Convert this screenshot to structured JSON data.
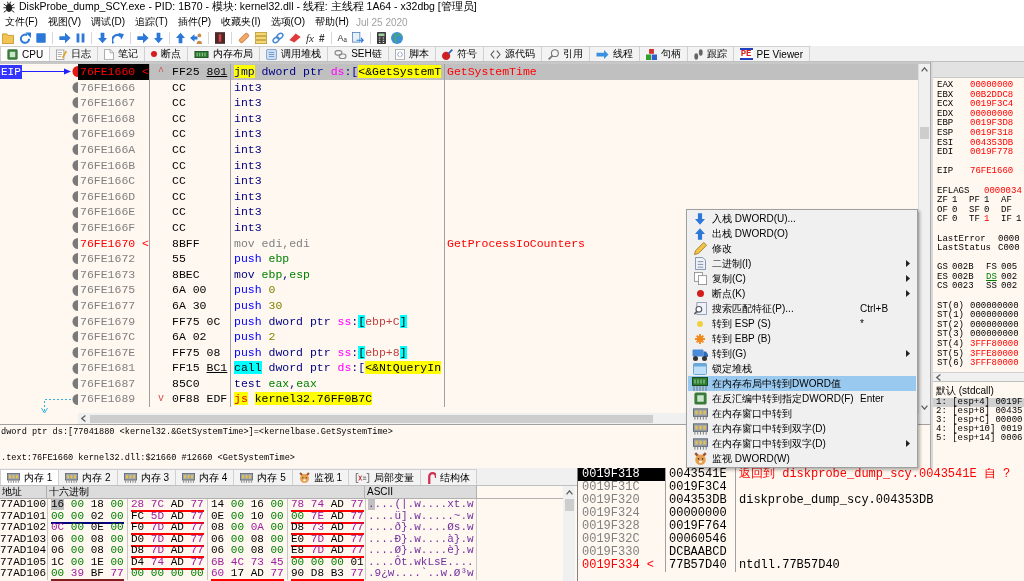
{
  "window": {
    "title": "DiskProbe_dump_SCY.exe - PID: 1B70 - 模块: kernel32.dll - 线程: 主线程 1A64 - x32dbg [管理员]"
  },
  "menu": [
    "文件(F)",
    "视图(V)",
    "调试(D)",
    "追踪(T)",
    "插件(P)",
    "收藏夹(I)",
    "选项(O)",
    "帮助(H)"
  ],
  "build_date": "Jul 25 2020",
  "toolbar_glyphs": [
    "fx",
    "#",
    "Aₐ"
  ],
  "tabs": [
    {
      "label": "CPU",
      "selected": true
    },
    {
      "label": "日志",
      "selected": false
    },
    {
      "label": "笔记",
      "selected": false
    },
    {
      "label": "断点",
      "selected": false
    },
    {
      "label": "内存布局",
      "selected": false
    },
    {
      "label": "调用堆栈",
      "selected": false
    },
    {
      "label": "SEH链",
      "selected": false
    },
    {
      "label": "脚本",
      "selected": false
    },
    {
      "label": "符号",
      "selected": false
    },
    {
      "label": "源代码",
      "selected": false
    },
    {
      "label": "引用",
      "selected": false
    },
    {
      "label": "线程",
      "selected": false
    },
    {
      "label": "句柄",
      "selected": false
    },
    {
      "label": "跟踪",
      "selected": false
    },
    {
      "label": "PE Viewer",
      "badge": "PE",
      "selected": false
    }
  ],
  "disassembly": {
    "eip_marker": "EIP",
    "rows": [
      {
        "address": "76FE1660",
        "marker": "<",
        "label": true,
        "selected": true,
        "breakpoint": true,
        "jump_arrow": "^",
        "bytes": "FF25",
        "reloc": "801",
        "tokens": [
          {
            "text": "jmp",
            "kind": "jump"
          },
          {
            "text": " dword ptr ",
            "kind": "text"
          },
          {
            "text": "ds",
            "kind": "segment"
          },
          {
            "text": ":[",
            "kind": "text"
          },
          {
            "text": "<&GetSystemT",
            "kind": "symbol"
          }
        ],
        "comment": "GetSystemTime"
      },
      {
        "address": "76FE1666",
        "label": false,
        "selected": false,
        "breakpoint": false,
        "bytes": "CC",
        "tokens": [
          {
            "text": "int3",
            "kind": "op"
          }
        ]
      },
      {
        "address": "76FE1667",
        "label": false,
        "selected": false,
        "breakpoint": false,
        "bytes": "CC",
        "tokens": [
          {
            "text": "int3",
            "kind": "op"
          }
        ]
      },
      {
        "address": "76FE1668",
        "label": false,
        "selected": false,
        "breakpoint": false,
        "bytes": "CC",
        "tokens": [
          {
            "text": "int3",
            "kind": "op"
          }
        ]
      },
      {
        "address": "76FE1669",
        "label": false,
        "selected": false,
        "breakpoint": false,
        "bytes": "CC",
        "tokens": [
          {
            "text": "int3",
            "kind": "op"
          }
        ]
      },
      {
        "address": "76FE166A",
        "label": false,
        "selected": false,
        "breakpoint": false,
        "bytes": "CC",
        "tokens": [
          {
            "text": "int3",
            "kind": "op"
          }
        ]
      },
      {
        "address": "76FE166B",
        "label": false,
        "selected": false,
        "breakpoint": false,
        "bytes": "CC",
        "tokens": [
          {
            "text": "int3",
            "kind": "op"
          }
        ]
      },
      {
        "address": "76FE166C",
        "label": false,
        "selected": false,
        "breakpoint": false,
        "bytes": "CC",
        "tokens": [
          {
            "text": "int3",
            "kind": "op"
          }
        ]
      },
      {
        "address": "76FE166D",
        "label": false,
        "selected": false,
        "breakpoint": false,
        "bytes": "CC",
        "tokens": [
          {
            "text": "int3",
            "kind": "op"
          }
        ]
      },
      {
        "address": "76FE166E",
        "label": false,
        "selected": false,
        "breakpoint": false,
        "bytes": "CC",
        "tokens": [
          {
            "text": "int3",
            "kind": "op"
          }
        ]
      },
      {
        "address": "76FE166F",
        "label": false,
        "selected": false,
        "breakpoint": false,
        "bytes": "CC",
        "tokens": [
          {
            "text": "int3",
            "kind": "op"
          }
        ]
      },
      {
        "address": "76FE1670",
        "marker": "<",
        "label": true,
        "selected": false,
        "breakpoint": false,
        "bytes": "8BFF",
        "tokens": [
          {
            "text": "mov edi,edi",
            "kind": "filler"
          }
        ],
        "comment": "GetProcessIoCounters"
      },
      {
        "address": "76FE1672",
        "label": false,
        "selected": false,
        "breakpoint": false,
        "bytes": "55",
        "tokens": [
          {
            "text": "push",
            "kind": "push"
          },
          {
            "text": " ebp",
            "kind": "register"
          }
        ]
      },
      {
        "address": "76FE1673",
        "label": false,
        "selected": false,
        "breakpoint": false,
        "bytes": "8BEC",
        "tokens": [
          {
            "text": "mov",
            "kind": "op"
          },
          {
            "text": " ebp",
            "kind": "register"
          },
          {
            "text": ",",
            "kind": "text"
          },
          {
            "text": "esp",
            "kind": "register"
          }
        ]
      },
      {
        "address": "76FE1675",
        "label": false,
        "selected": false,
        "breakpoint": false,
        "bytes": "6A 00",
        "tokens": [
          {
            "text": "push",
            "kind": "push"
          },
          {
            "text": " 0",
            "kind": "number"
          }
        ]
      },
      {
        "address": "76FE1677",
        "label": false,
        "selected": false,
        "breakpoint": false,
        "bytes": "6A 30",
        "tokens": [
          {
            "text": "push",
            "kind": "push"
          },
          {
            "text": " 30",
            "kind": "number"
          }
        ]
      },
      {
        "address": "76FE1679",
        "label": false,
        "selected": false,
        "breakpoint": false,
        "bytes": "FF75 0C",
        "tokens": [
          {
            "text": "push",
            "kind": "push"
          },
          {
            "text": " dword ptr ",
            "kind": "text"
          },
          {
            "text": "ss",
            "kind": "segment"
          },
          {
            "text": ":",
            "kind": "text"
          },
          {
            "text": "[",
            "kind": "bracket"
          },
          {
            "text": "ebp+C",
            "kind": "memory"
          },
          {
            "text": "]",
            "kind": "bracket"
          }
        ]
      },
      {
        "address": "76FE167C",
        "label": false,
        "selected": false,
        "breakpoint": false,
        "bytes": "6A 02",
        "tokens": [
          {
            "text": "push",
            "kind": "push"
          },
          {
            "text": " 2",
            "kind": "number"
          }
        ]
      },
      {
        "address": "76FE167E",
        "label": false,
        "selected": false,
        "breakpoint": false,
        "bytes": "FF75 08",
        "tokens": [
          {
            "text": "push",
            "kind": "push"
          },
          {
            "text": " dword ptr ",
            "kind": "text"
          },
          {
            "text": "ss",
            "kind": "segment"
          },
          {
            "text": ":",
            "kind": "text"
          },
          {
            "text": "[",
            "kind": "bracket"
          },
          {
            "text": "ebp+8",
            "kind": "memory"
          },
          {
            "text": "]",
            "kind": "bracket"
          }
        ]
      },
      {
        "address": "76FE1681",
        "label": false,
        "selected": false,
        "breakpoint": false,
        "bytes": "FF15",
        "reloc": "BC1",
        "tokens": [
          {
            "text": "call",
            "kind": "call"
          },
          {
            "text": " dword ptr ",
            "kind": "text"
          },
          {
            "text": "ds",
            "kind": "segment"
          },
          {
            "text": ":[",
            "kind": "text"
          },
          {
            "text": "<&NtQueryIn",
            "kind": "symbol"
          }
        ]
      },
      {
        "address": "76FE1687",
        "label": false,
        "selected": false,
        "breakpoint": false,
        "bytes": "85C0",
        "tokens": [
          {
            "text": "test",
            "kind": "op"
          },
          {
            "text": " eax",
            "kind": "register"
          },
          {
            "text": ",",
            "kind": "text"
          },
          {
            "text": "eax",
            "kind": "register"
          }
        ]
      },
      {
        "address": "76FE1689",
        "label": false,
        "selected": false,
        "breakpoint": false,
        "jump_arrow": "v",
        "bytes": "0F88 EDF",
        "tokens": [
          {
            "text": "js",
            "kind": "cjump"
          },
          {
            "text": "kernel32.76FF0B7C",
            "kind": "target"
          }
        ]
      }
    ]
  },
  "info": [
    "dword ptr ds:[77041880 <kernel32.&GetSystemTime>]=<kernelbase.GetSystemTime>",
    ".text:76FE1660 kernel32.dll:$21660 #12660 <GetSystemTime>"
  ],
  "registers": {
    "groups": [
      {
        "kind": "general",
        "rows": [
          [
            {
              "name": "EAX",
              "value": "00000000",
              "changed": true
            }
          ],
          [
            {
              "name": "EBX",
              "value": "00B2DDC8",
              "changed": true
            }
          ],
          [
            {
              "name": "ECX",
              "value": "0019F3C4",
              "changed": true
            }
          ],
          [
            {
              "name": "EDX",
              "value": "00000000",
              "changed": true
            }
          ],
          [
            {
              "name": "EBP",
              "value": "0019F3D8",
              "changed": true
            }
          ],
          [
            {
              "name": "ESP",
              "value": "0019F318",
              "changed": true
            }
          ],
          [
            {
              "name": "ESI",
              "value": "004353DB",
              "changed": true
            }
          ],
          [
            {
              "name": "EDI",
              "value": "0019F778",
              "changed": true
            }
          ]
        ]
      },
      {
        "kind": "general",
        "rows": [
          [
            {
              "name": "EIP",
              "value": "76FE1660",
              "changed": true
            }
          ]
        ]
      },
      {
        "kind": "eflags",
        "rows": [
          [
            {
              "name": "EFLAGS",
              "value": "0000034",
              "changed": true
            }
          ]
        ]
      },
      {
        "kind": "flags",
        "rows": [
          [
            {
              "name": "ZF",
              "value": "1",
              "changed": false
            },
            {
              "name": "PF",
              "value": "1",
              "changed": false
            },
            {
              "name": "AF"
            }
          ],
          [
            {
              "name": "OF",
              "value": "0",
              "changed": false
            },
            {
              "name": "SF",
              "value": "0",
              "changed": false
            },
            {
              "name": "DF"
            }
          ],
          [
            {
              "name": "CF",
              "value": "0",
              "changed": false
            },
            {
              "name": "TF",
              "value": "1",
              "changed": true
            },
            {
              "name": "IF",
              "value": "1",
              "changed": false
            }
          ]
        ]
      },
      {
        "kind": "error",
        "rows": [
          [
            {
              "name": "LastError",
              "value": "0000",
              "changed": false
            }
          ],
          [
            {
              "name": "LastStatus",
              "value": "C000",
              "changed": false
            }
          ]
        ]
      },
      {
        "kind": "segment",
        "rows": [
          [
            {
              "name": "GS",
              "value": "002B",
              "changed": false,
              "highlighted": false
            },
            {
              "name": "FS",
              "value": "005",
              "changed": false,
              "highlighted": false
            }
          ],
          [
            {
              "name": "ES",
              "value": "002B",
              "changed": false,
              "highlighted": false
            },
            {
              "name": "DS",
              "value": "002",
              "changed": false,
              "highlighted": true
            }
          ],
          [
            {
              "name": "CS",
              "value": "0023",
              "changed": false,
              "highlighted": false
            },
            {
              "name": "SS",
              "value": "002",
              "changed": false,
              "highlighted": false
            }
          ]
        ]
      },
      {
        "kind": "fpu",
        "rows": [
          [
            {
              "name": "ST(0)",
              "value": "000000000",
              "changed": false
            }
          ],
          [
            {
              "name": "ST(1)",
              "value": "000000000",
              "changed": false
            }
          ],
          [
            {
              "name": "ST(2)",
              "value": "000000000",
              "changed": false
            }
          ],
          [
            {
              "name": "ST(3)",
              "value": "000000000",
              "changed": false
            }
          ],
          [
            {
              "name": "ST(4)",
              "value": "3FFF80000",
              "changed": true
            }
          ],
          [
            {
              "name": "ST(5)",
              "value": "3FFE80000",
              "changed": true
            }
          ],
          [
            {
              "name": "ST(6)",
              "value": "3FFF80000",
              "changed": true
            }
          ]
        ]
      }
    ]
  },
  "call_args": {
    "title": "默认 (stdcall)",
    "rows": [
      {
        "index": "1:",
        "slot": "[esp+4]",
        "value": "0019F",
        "selected": true
      },
      {
        "index": "2:",
        "slot": "[esp+8]",
        "value": "00435",
        "selected": false
      },
      {
        "index": "3:",
        "slot": "[esp+C]",
        "value": "00000",
        "selected": false
      },
      {
        "index": "4:",
        "slot": "[esp+10]",
        "value": "0019",
        "selected": false
      },
      {
        "index": "5:",
        "slot": "[esp+14]",
        "value": "0006",
        "selected": false
      }
    ]
  },
  "memory_tabs": [
    {
      "label": "内存 1",
      "selected": true
    },
    {
      "label": "内存 2",
      "selected": false
    },
    {
      "label": "内存 3",
      "selected": false
    },
    {
      "label": "内存 4",
      "selected": false
    },
    {
      "label": "内存 5",
      "selected": false
    },
    {
      "label": "监视 1",
      "selected": false
    },
    {
      "label": "局部变量",
      "selected": false
    },
    {
      "label": "结构体",
      "selected": false
    }
  ],
  "dump": {
    "columns": [
      "地址",
      "十六进制",
      "ASCII"
    ],
    "cursor_on_first_byte": true,
    "rows": [
      {
        "address": "77AD100",
        "groups": [
          {
            "bytes": "16 00 18 00"
          },
          {
            "bytes": "28 7C AD 77",
            "color": "#ff0000"
          },
          {
            "bytes": "14 00 16 00"
          },
          {
            "bytes": "78 74 AD 77",
            "color": "#ff0000"
          }
        ],
        "ascii": "....(|.w....xt.w"
      },
      {
        "address": "77AD101",
        "groups": [
          {
            "bytes": "00 00 02 00",
            "color": "#000080"
          },
          {
            "bytes": "FC 5D AD 77",
            "color": "#ff0000"
          },
          {
            "bytes": "0E 00 10 00"
          },
          {
            "bytes": "00 7E AD 77",
            "color": "#ff0000"
          }
        ],
        "ascii": "....ü].w.....~.w"
      },
      {
        "address": "77AD102",
        "groups": [
          {
            "bytes": "0C 00 0E 00"
          },
          {
            "bytes": "F0 7D AD 77",
            "color": "#ff0000"
          },
          {
            "bytes": "08 00 0A 00"
          },
          {
            "bytes": "D8 73 AD 77",
            "color": "#ff0000"
          }
        ],
        "ascii": "....ð}.w....Øs.w"
      },
      {
        "address": "77AD103",
        "groups": [
          {
            "bytes": "06 00 08 00"
          },
          {
            "bytes": "D0 7D AD 77",
            "color": "#ff0000"
          },
          {
            "bytes": "06 00 08 00"
          },
          {
            "bytes": "E0 7D AD 77",
            "color": "#ff0000"
          }
        ],
        "ascii": "....Ð}.w....à}.w"
      },
      {
        "address": "77AD104",
        "groups": [
          {
            "bytes": "06 00 08 00"
          },
          {
            "bytes": "D8 7D AD 77",
            "color": "#ff0000"
          },
          {
            "bytes": "06 00 08 00"
          },
          {
            "bytes": "E8 7D AD 77",
            "color": "#ff0000"
          }
        ],
        "ascii": "....Ø}.w....è}.w"
      },
      {
        "address": "77AD105",
        "groups": [
          {
            "bytes": "1C 00 1E 00"
          },
          {
            "bytes": "D4 74 AD 77",
            "color": "#ff0000"
          },
          {
            "bytes": "6B 4C 73 45"
          },
          {
            "bytes": "00 00 00 01"
          }
        ],
        "ascii": "....Ôt.wkLsE...."
      },
      {
        "address": "77AD106",
        "groups": [
          {
            "bytes": "00 39 BF 77",
            "color": "#802020"
          },
          {
            "bytes": "00 00 00 00"
          },
          {
            "bytes": "60 17 AD 77",
            "color": "#ff0000"
          },
          {
            "bytes": "90 D8 B3 77",
            "color": "#ff0000"
          }
        ],
        "ascii": ".9¿w....`..w.Ø³w"
      }
    ]
  },
  "stack": {
    "rows": [
      {
        "address": "0019F318",
        "selected": true,
        "label": false,
        "value": "0043541E",
        "comment": {
          "text": "返回到 diskprobe_dump_scy.0043541E 自 ?",
          "kind": "return"
        }
      },
      {
        "address": "0019F31C",
        "selected": false,
        "label": false,
        "value": "0019F3C4"
      },
      {
        "address": "0019F320",
        "selected": false,
        "label": false,
        "value": "004353DB",
        "comment": {
          "text": "diskprobe_dump_scy.004353DB",
          "kind": "plain"
        }
      },
      {
        "address": "0019F324",
        "selected": false,
        "label": false,
        "value": "00000000"
      },
      {
        "address": "0019F328",
        "selected": false,
        "label": false,
        "value": "0019F764"
      },
      {
        "address": "0019F32C",
        "selected": false,
        "label": false,
        "value": "00060546"
      },
      {
        "address": "0019F330",
        "selected": false,
        "label": false,
        "value": "DCBAABCD"
      },
      {
        "address": "0019F334",
        "marker": "<",
        "selected": false,
        "label": true,
        "value": "77B57D40",
        "comment": {
          "text": "ntdll.77B57D40",
          "kind": "plain"
        }
      }
    ]
  },
  "context_menu": {
    "items": [
      {
        "label": "入栈 DWORD(U)...",
        "submenu": false,
        "selected": false
      },
      {
        "label": "出栈 DWORD(O)",
        "submenu": false,
        "selected": false
      },
      {
        "label": "修改",
        "submenu": false,
        "selected": false
      },
      {
        "label": "二进制(I)",
        "submenu": true,
        "selected": false
      },
      {
        "label": "复制(C)",
        "submenu": true,
        "selected": false
      },
      {
        "label": "断点(K)",
        "submenu": true,
        "selected": false
      },
      {
        "label": "搜索匹配特征(P)...",
        "shortcut": "Ctrl+B",
        "submenu": false,
        "selected": false
      },
      {
        "label": "转到 ESP (S)",
        "shortcut": "*",
        "submenu": false,
        "selected": false
      },
      {
        "label": "转到 EBP (B)",
        "submenu": false,
        "selected": false
      },
      {
        "label": "转到(G)",
        "submenu": true,
        "selected": false
      },
      {
        "label": "锁定堆栈",
        "submenu": false,
        "selected": false
      },
      {
        "label": "在内存布局中转到DWORD值",
        "submenu": false,
        "selected": true
      },
      {
        "label": "在反汇编中转到指定DWORD(F)",
        "shortcut": "Enter",
        "submenu": false,
        "selected": false
      },
      {
        "label": "在内存窗口中转到",
        "submenu": false,
        "selected": false
      },
      {
        "label": "在内存窗口中转到双字(D)",
        "submenu": false,
        "selected": false
      },
      {
        "label": "在内存窗口中转到双字(D)",
        "submenu": true,
        "selected": false
      },
      {
        "label": "监视 DWORD(W)",
        "submenu": false,
        "selected": false
      }
    ]
  }
}
